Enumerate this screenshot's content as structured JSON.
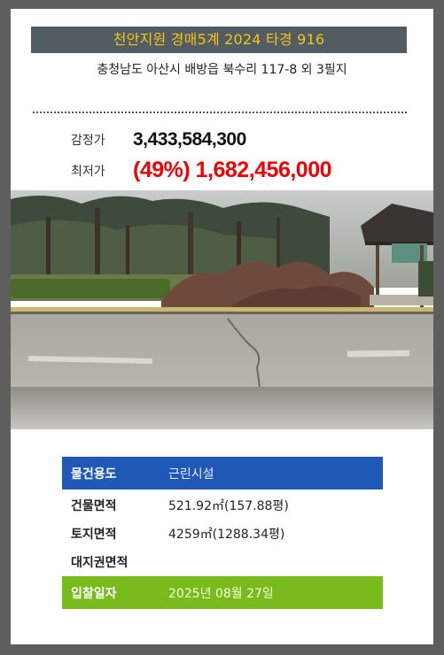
{
  "header": {
    "title": "천안지원 경매5계 2024 타경 916",
    "address": "충청남도 아산시 배방읍 북수리 117-8 외 3필지"
  },
  "prices": {
    "appraisal_label": "감정가",
    "appraisal_value": "3,433,584,300",
    "minimum_label": "최저가",
    "minimum_value": "(49%) 1,682,456,000"
  },
  "details": {
    "usage_label": "물건용도",
    "usage_value": "근린시설",
    "building_area_label": "건물면적",
    "building_area_value": "521.92㎡(157.88평)",
    "land_area_label": "토지면적",
    "land_area_value": "4259㎡(1288.34평)",
    "land_rights_label": "대지권면적",
    "land_rights_value": "",
    "bid_date_label": "입찰일자",
    "bid_date_value": "2025년 08월 27일"
  },
  "colors": {
    "title_bar": "#535b63",
    "title_text": "#f3c515",
    "minimum_price": "#f40000",
    "usage_bar": "#1f58b6",
    "bid_bar": "#79ba1c"
  }
}
